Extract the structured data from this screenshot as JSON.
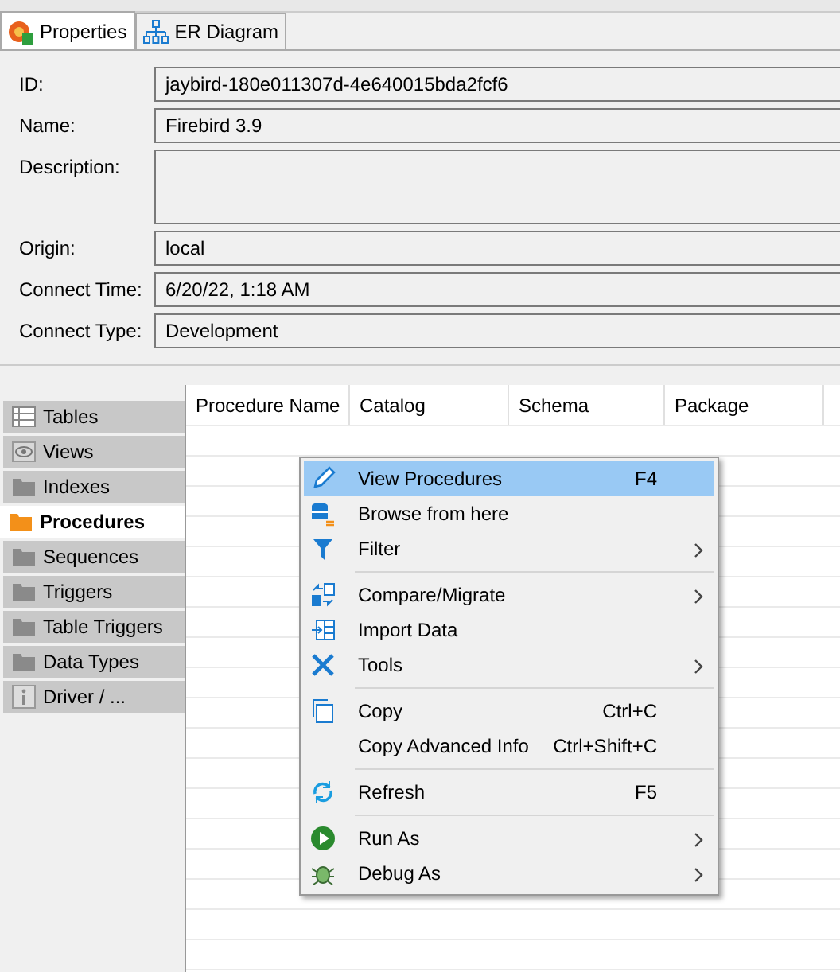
{
  "view_tabs": [
    {
      "label": "Properties",
      "selected": true
    },
    {
      "label": "ER Diagram",
      "selected": false
    }
  ],
  "properties": [
    {
      "label": "ID:",
      "value": "jaybird-180e011307d-4e640015bda2fcf6",
      "kind": "line"
    },
    {
      "label": "Name:",
      "value": "Firebird 3.9",
      "kind": "line"
    },
    {
      "label": "Description:",
      "kind": "area"
    },
    {
      "label": "Origin:",
      "value": "local",
      "kind": "line"
    },
    {
      "label": "Connect Time:",
      "value": "6/20/22, 1:18 AM",
      "kind": "line"
    },
    {
      "label": "Connect Type:",
      "value": "Development",
      "kind": "line"
    }
  ],
  "sidebar": {
    "items": [
      {
        "label": "Tables",
        "selected": false
      },
      {
        "label": "Views",
        "selected": false
      },
      {
        "label": "Indexes",
        "selected": false
      },
      {
        "label": "Procedures",
        "selected": true
      },
      {
        "label": "Sequences",
        "selected": false
      },
      {
        "label": "Triggers",
        "selected": false
      },
      {
        "label": "Table Triggers",
        "selected": false
      },
      {
        "label": "Data Types",
        "selected": false
      },
      {
        "label": "Driver / ...",
        "selected": false
      }
    ]
  },
  "table": {
    "columns": [
      "Procedure Name",
      "Catalog",
      "Schema",
      "Package"
    ]
  },
  "context_menu": {
    "items": [
      {
        "kind": "item",
        "label": "View Procedures",
        "shortcut": "F4",
        "submenu": false,
        "selected": true
      },
      {
        "kind": "item",
        "label": "Browse from here",
        "submenu": false,
        "selected": false
      },
      {
        "kind": "item",
        "label": "Filter",
        "submenu": true,
        "selected": false
      },
      {
        "kind": "separator"
      },
      {
        "kind": "item",
        "label": "Compare/Migrate",
        "submenu": true,
        "selected": false
      },
      {
        "kind": "item",
        "label": "Import Data",
        "submenu": false,
        "selected": false
      },
      {
        "kind": "item",
        "label": "Tools",
        "submenu": true,
        "selected": false
      },
      {
        "kind": "separator"
      },
      {
        "kind": "item",
        "label": "Copy",
        "shortcut": "Ctrl+C",
        "submenu": false,
        "selected": false
      },
      {
        "kind": "item",
        "label": "Copy Advanced Info",
        "shortcut": "Ctrl+Shift+C",
        "submenu": false,
        "selected": false
      },
      {
        "kind": "separator"
      },
      {
        "kind": "item",
        "label": "Refresh",
        "shortcut": "F5",
        "submenu": false,
        "selected": false
      },
      {
        "kind": "separator"
      },
      {
        "kind": "item",
        "label": "Run As",
        "submenu": true,
        "selected": false
      },
      {
        "kind": "item",
        "label": "Debug As",
        "submenu": true,
        "selected": false
      }
    ]
  }
}
